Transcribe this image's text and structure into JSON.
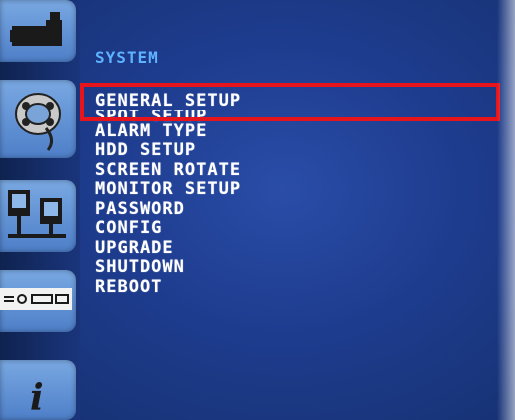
{
  "menu": {
    "title": "SYSTEM",
    "items": [
      {
        "label": "GENERAL SETUP",
        "selected": true
      },
      {
        "label": "SPOT SETUP"
      },
      {
        "label": "ALARM TYPE"
      },
      {
        "label": "HDD SETUP"
      },
      {
        "label": "SCREEN ROTATE"
      },
      {
        "label": "MONITOR SETUP"
      },
      {
        "label": "PASSWORD"
      },
      {
        "label": "CONFIG"
      },
      {
        "label": "UPGRADE"
      },
      {
        "label": "SHUTDOWN"
      },
      {
        "label": "REBOOT"
      }
    ]
  },
  "sidebar": {
    "icons": [
      "camera-icon",
      "film-reel-icon",
      "network-computers-icon",
      "dvr-device-icon",
      "info-icon"
    ],
    "info_glyph": "i"
  },
  "colors": {
    "background": "#1e3c8e",
    "title": "#5fb2ff",
    "text": "#ffffff",
    "highlight": "#e8141c",
    "tile": "#5b8bd0"
  }
}
